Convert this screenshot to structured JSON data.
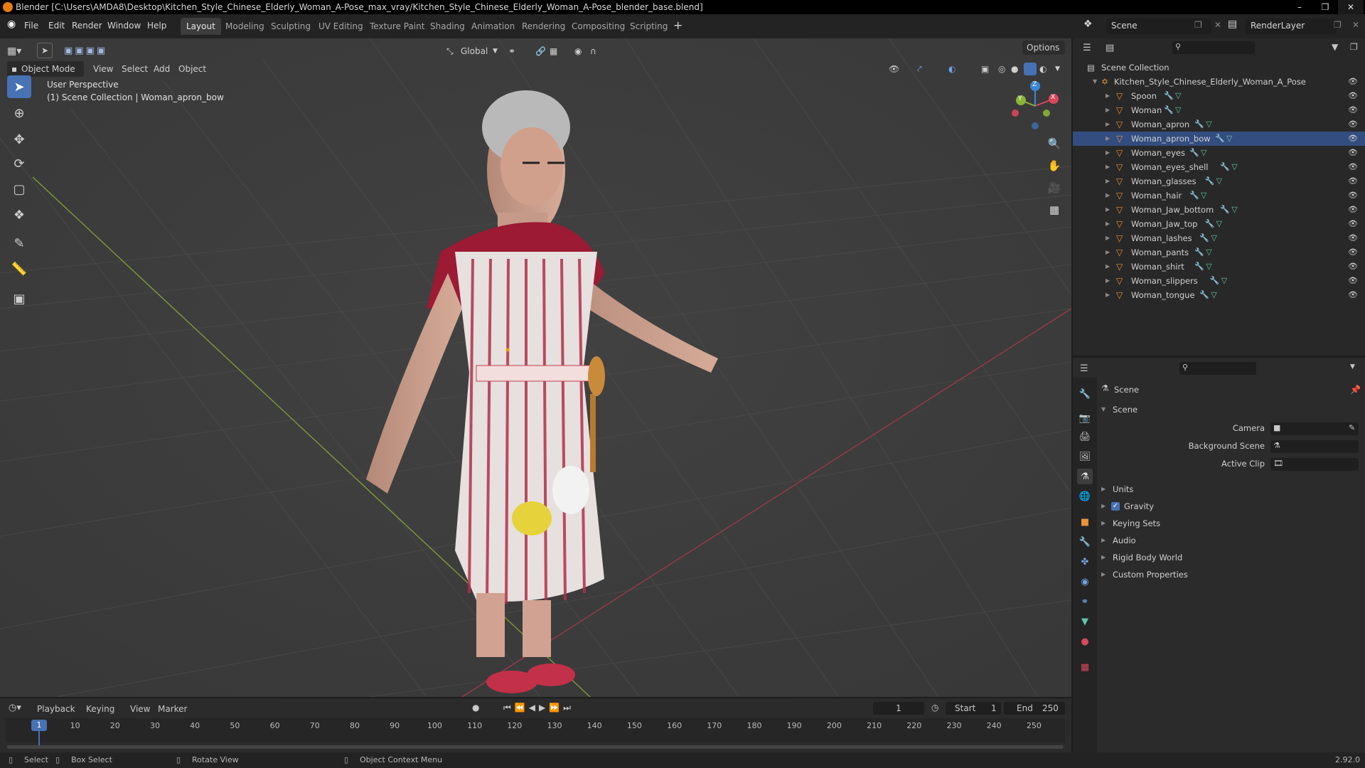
{
  "window": {
    "title": "Blender [C:\\Users\\AMDA8\\Desktop\\Kitchen_Style_Chinese_Elderly_Woman_A-Pose_max_vray/Kitchen_Style_Chinese_Elderly_Woman_A-Pose_blender_base.blend]"
  },
  "menu": [
    "File",
    "Edit",
    "Render",
    "Window",
    "Help"
  ],
  "workspaces": [
    "Layout",
    "Modeling",
    "Sculpting",
    "UV Editing",
    "Texture Paint",
    "Shading",
    "Animation",
    "Rendering",
    "Compositing",
    "Scripting"
  ],
  "active_workspace": "Layout",
  "scene_selector": "Scene",
  "view_layer": "RenderLayer",
  "viewport": {
    "mode": "Object Mode",
    "menus": [
      "View",
      "Select",
      "Add",
      "Object"
    ],
    "transform_orientation": "Global",
    "options_label": "Options",
    "info_line1": "User Perspective",
    "info_line2": "(1) Scene Collection | Woman_apron_bow",
    "gizmo_axes": {
      "x": "X",
      "y": "Y",
      "z": "Z"
    },
    "colors": {
      "x_axis": "#d9485b",
      "y_axis": "#8bb33a",
      "z_axis": "#3a87d9"
    }
  },
  "outliner": {
    "root": "Scene Collection",
    "collection": "Kitchen_Style_Chinese_Elderly_Woman_A_Pose",
    "selected": "Woman_apron_bow",
    "objects": [
      "Spoon",
      "Woman",
      "Woman_apron",
      "Woman_apron_bow",
      "Woman_eyes",
      "Woman_eyes_shell",
      "Woman_glasses",
      "Woman_hair",
      "Woman_Jaw_bottom",
      "Woman_Jaw_top",
      "Woman_lashes",
      "Woman_pants",
      "Woman_shirt",
      "Woman_slippers",
      "Woman_tongue"
    ]
  },
  "properties": {
    "context": "Scene",
    "panel": "Scene",
    "fields": [
      {
        "label": "Camera",
        "value": ""
      },
      {
        "label": "Background Scene",
        "value": ""
      },
      {
        "label": "Active Clip",
        "value": ""
      }
    ],
    "subpanels": [
      "Units",
      "Gravity",
      "Keying Sets",
      "Audio",
      "Rigid Body World",
      "Custom Properties"
    ],
    "gravity_checked": true
  },
  "timeline": {
    "menus": [
      "Playback",
      "Keying",
      "View",
      "Marker"
    ],
    "current_frame": "1",
    "start_label": "Start",
    "start": "1",
    "end_label": "End",
    "end": "250",
    "ticks": [
      "10",
      "20",
      "30",
      "40",
      "50",
      "60",
      "70",
      "80",
      "90",
      "100",
      "110",
      "120",
      "130",
      "140",
      "150",
      "160",
      "170",
      "180",
      "190",
      "200",
      "210",
      "220",
      "230",
      "240",
      "250"
    ]
  },
  "status": {
    "select": "Select",
    "box_select": "Box Select",
    "rotate_view": "Rotate View",
    "context_menu": "Object Context Menu",
    "version": "2.92.0"
  }
}
